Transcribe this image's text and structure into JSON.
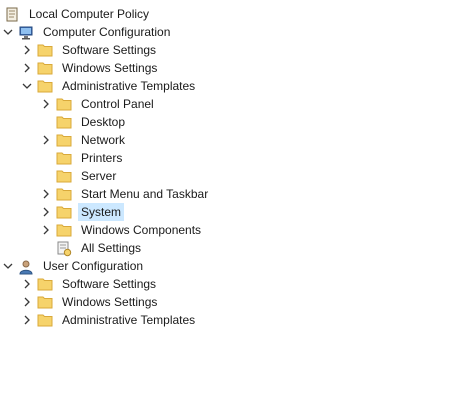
{
  "tree": {
    "root": {
      "label": "Local Computer Policy",
      "icon": "policy-document-icon"
    },
    "computer_config": {
      "label": "Computer Configuration",
      "icon": "computer-icon",
      "children": {
        "software_settings": {
          "label": "Software Settings"
        },
        "windows_settings": {
          "label": "Windows Settings"
        },
        "admin_templates": {
          "label": "Administrative Templates",
          "children": {
            "control_panel": "Control Panel",
            "desktop": "Desktop",
            "network": "Network",
            "printers": "Printers",
            "server": "Server",
            "start_menu": "Start Menu and Taskbar",
            "system": "System",
            "windows_components": "Windows Components",
            "all_settings": "All Settings"
          }
        }
      }
    },
    "user_config": {
      "label": "User Configuration",
      "icon": "user-icon",
      "children": {
        "software_settings": "Software Settings",
        "windows_settings": "Windows Settings",
        "admin_templates": "Administrative Templates"
      }
    },
    "selected_item": "System"
  },
  "colors": {
    "folder": "#f6d36b",
    "folder_dark": "#d9a93a",
    "selection": "#cce8ff",
    "chevron": "#3a3a3a"
  }
}
